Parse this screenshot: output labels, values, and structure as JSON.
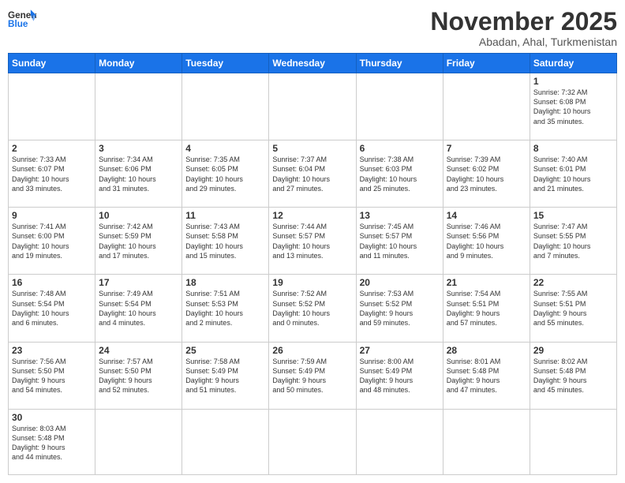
{
  "logo": {
    "text_general": "General",
    "text_blue": "Blue"
  },
  "header": {
    "month": "November 2025",
    "location": "Abadan, Ahal, Turkmenistan"
  },
  "weekdays": [
    "Sunday",
    "Monday",
    "Tuesday",
    "Wednesday",
    "Thursday",
    "Friday",
    "Saturday"
  ],
  "days": [
    {
      "date": "",
      "info": ""
    },
    {
      "date": "",
      "info": ""
    },
    {
      "date": "",
      "info": ""
    },
    {
      "date": "",
      "info": ""
    },
    {
      "date": "",
      "info": ""
    },
    {
      "date": "",
      "info": ""
    },
    {
      "date": "1",
      "info": "Sunrise: 7:32 AM\nSunset: 6:08 PM\nDaylight: 10 hours\nand 35 minutes."
    },
    {
      "date": "2",
      "info": "Sunrise: 7:33 AM\nSunset: 6:07 PM\nDaylight: 10 hours\nand 33 minutes."
    },
    {
      "date": "3",
      "info": "Sunrise: 7:34 AM\nSunset: 6:06 PM\nDaylight: 10 hours\nand 31 minutes."
    },
    {
      "date": "4",
      "info": "Sunrise: 7:35 AM\nSunset: 6:05 PM\nDaylight: 10 hours\nand 29 minutes."
    },
    {
      "date": "5",
      "info": "Sunrise: 7:37 AM\nSunset: 6:04 PM\nDaylight: 10 hours\nand 27 minutes."
    },
    {
      "date": "6",
      "info": "Sunrise: 7:38 AM\nSunset: 6:03 PM\nDaylight: 10 hours\nand 25 minutes."
    },
    {
      "date": "7",
      "info": "Sunrise: 7:39 AM\nSunset: 6:02 PM\nDaylight: 10 hours\nand 23 minutes."
    },
    {
      "date": "8",
      "info": "Sunrise: 7:40 AM\nSunset: 6:01 PM\nDaylight: 10 hours\nand 21 minutes."
    },
    {
      "date": "9",
      "info": "Sunrise: 7:41 AM\nSunset: 6:00 PM\nDaylight: 10 hours\nand 19 minutes."
    },
    {
      "date": "10",
      "info": "Sunrise: 7:42 AM\nSunset: 5:59 PM\nDaylight: 10 hours\nand 17 minutes."
    },
    {
      "date": "11",
      "info": "Sunrise: 7:43 AM\nSunset: 5:58 PM\nDaylight: 10 hours\nand 15 minutes."
    },
    {
      "date": "12",
      "info": "Sunrise: 7:44 AM\nSunset: 5:57 PM\nDaylight: 10 hours\nand 13 minutes."
    },
    {
      "date": "13",
      "info": "Sunrise: 7:45 AM\nSunset: 5:57 PM\nDaylight: 10 hours\nand 11 minutes."
    },
    {
      "date": "14",
      "info": "Sunrise: 7:46 AM\nSunset: 5:56 PM\nDaylight: 10 hours\nand 9 minutes."
    },
    {
      "date": "15",
      "info": "Sunrise: 7:47 AM\nSunset: 5:55 PM\nDaylight: 10 hours\nand 7 minutes."
    },
    {
      "date": "16",
      "info": "Sunrise: 7:48 AM\nSunset: 5:54 PM\nDaylight: 10 hours\nand 6 minutes."
    },
    {
      "date": "17",
      "info": "Sunrise: 7:49 AM\nSunset: 5:54 PM\nDaylight: 10 hours\nand 4 minutes."
    },
    {
      "date": "18",
      "info": "Sunrise: 7:51 AM\nSunset: 5:53 PM\nDaylight: 10 hours\nand 2 minutes."
    },
    {
      "date": "19",
      "info": "Sunrise: 7:52 AM\nSunset: 5:52 PM\nDaylight: 10 hours\nand 0 minutes."
    },
    {
      "date": "20",
      "info": "Sunrise: 7:53 AM\nSunset: 5:52 PM\nDaylight: 9 hours\nand 59 minutes."
    },
    {
      "date": "21",
      "info": "Sunrise: 7:54 AM\nSunset: 5:51 PM\nDaylight: 9 hours\nand 57 minutes."
    },
    {
      "date": "22",
      "info": "Sunrise: 7:55 AM\nSunset: 5:51 PM\nDaylight: 9 hours\nand 55 minutes."
    },
    {
      "date": "23",
      "info": "Sunrise: 7:56 AM\nSunset: 5:50 PM\nDaylight: 9 hours\nand 54 minutes."
    },
    {
      "date": "24",
      "info": "Sunrise: 7:57 AM\nSunset: 5:50 PM\nDaylight: 9 hours\nand 52 minutes."
    },
    {
      "date": "25",
      "info": "Sunrise: 7:58 AM\nSunset: 5:49 PM\nDaylight: 9 hours\nand 51 minutes."
    },
    {
      "date": "26",
      "info": "Sunrise: 7:59 AM\nSunset: 5:49 PM\nDaylight: 9 hours\nand 50 minutes."
    },
    {
      "date": "27",
      "info": "Sunrise: 8:00 AM\nSunset: 5:49 PM\nDaylight: 9 hours\nand 48 minutes."
    },
    {
      "date": "28",
      "info": "Sunrise: 8:01 AM\nSunset: 5:48 PM\nDaylight: 9 hours\nand 47 minutes."
    },
    {
      "date": "29",
      "info": "Sunrise: 8:02 AM\nSunset: 5:48 PM\nDaylight: 9 hours\nand 45 minutes."
    },
    {
      "date": "30",
      "info": "Sunrise: 8:03 AM\nSunset: 5:48 PM\nDaylight: 9 hours\nand 44 minutes."
    },
    {
      "date": "",
      "info": ""
    },
    {
      "date": "",
      "info": ""
    },
    {
      "date": "",
      "info": ""
    },
    {
      "date": "",
      "info": ""
    },
    {
      "date": "",
      "info": ""
    },
    {
      "date": "",
      "info": ""
    }
  ]
}
